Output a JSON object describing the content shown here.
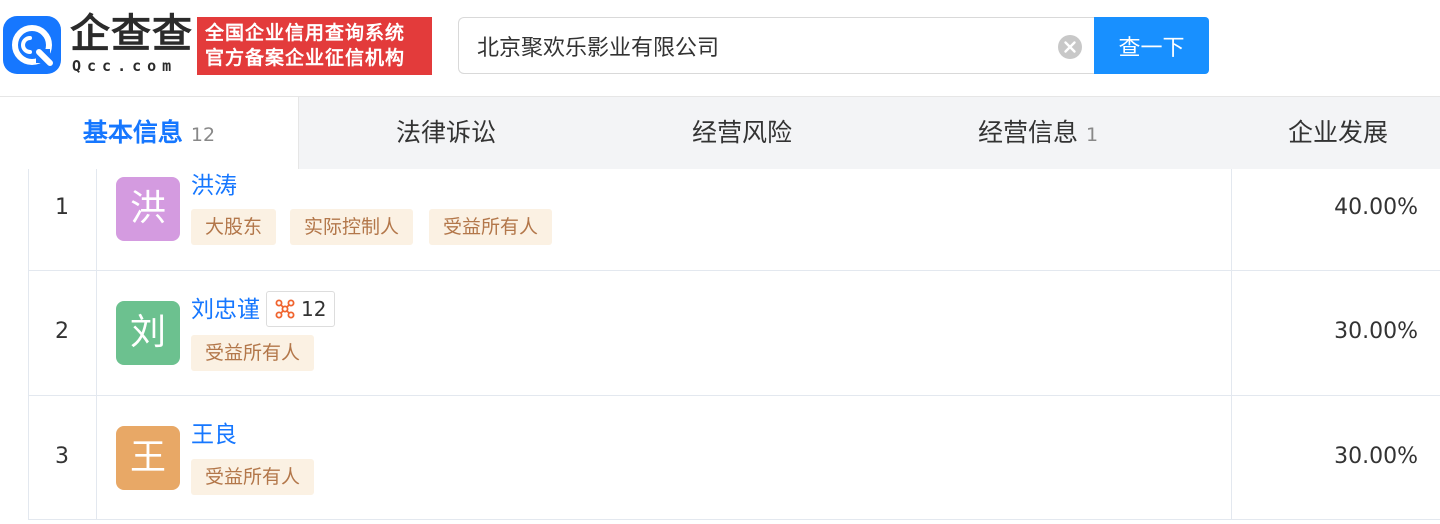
{
  "header": {
    "brand_name": "企查查",
    "brand_domain": "Qcc.com",
    "slogan_line1": "全国企业信用查询系统",
    "slogan_line2": "官方备案企业征信机构",
    "search_value": "北京聚欢乐影业有限公司",
    "search_button": "查一下"
  },
  "tabs": [
    {
      "label": "基本信息",
      "count": "12",
      "active": true
    },
    {
      "label": "法律诉讼",
      "count": "",
      "active": false
    },
    {
      "label": "经营风险",
      "count": "",
      "active": false
    },
    {
      "label": "经营信息",
      "count": "1",
      "active": false
    },
    {
      "label": "企业发展",
      "count": "",
      "active": false
    }
  ],
  "shareholders": [
    {
      "index": "1",
      "avatar_char": "洪",
      "avatar_color": "#d49be0",
      "name": "洪涛",
      "relation_count": "",
      "tags": [
        "大股东",
        "实际控制人",
        "受益所有人"
      ],
      "percent": "40.00%"
    },
    {
      "index": "2",
      "avatar_char": "刘",
      "avatar_color": "#6cc18f",
      "name": "刘忠谨",
      "relation_count": "12",
      "tags": [
        "受益所有人"
      ],
      "percent": "30.00%"
    },
    {
      "index": "3",
      "avatar_char": "王",
      "avatar_color": "#e8a866",
      "name": "王良",
      "relation_count": "",
      "tags": [
        "受益所有人"
      ],
      "percent": "30.00%"
    }
  ],
  "colors": {
    "brand_blue": "#1677ff",
    "slogan_red": "#e33b3b",
    "tag_bg": "#fbf1e3",
    "tag_text": "#b3774a"
  },
  "icons": [
    "qcc-logo-icon",
    "clear-icon",
    "relation-graph-icon"
  ]
}
